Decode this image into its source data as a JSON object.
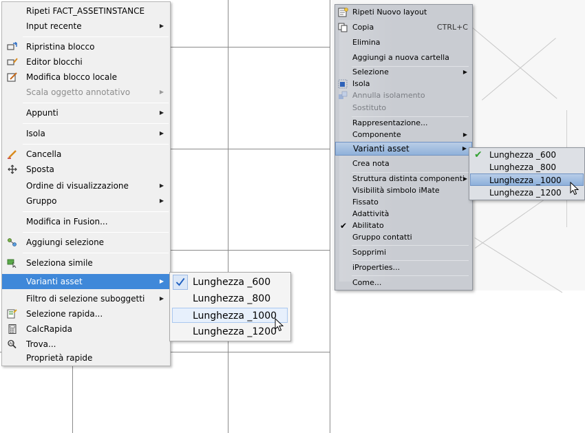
{
  "left_menu": {
    "items": [
      {
        "label": "Ripeti FACT_ASSETINSTANCE",
        "icon": "",
        "arrow": false,
        "disabled": false
      },
      {
        "label": "Input recente",
        "icon": "",
        "arrow": true,
        "disabled": false
      },
      {
        "label": "Ripristina blocco",
        "icon": "block-reset-icon",
        "arrow": false,
        "disabled": false
      },
      {
        "label": "Editor blocchi",
        "icon": "block-editor-icon",
        "arrow": false,
        "disabled": false
      },
      {
        "label": "Modifica blocco locale",
        "icon": "edit-block-icon",
        "arrow": false,
        "disabled": false
      },
      {
        "label": "Scala oggetto annotativo",
        "icon": "",
        "arrow": true,
        "disabled": true
      },
      {
        "label": "Appunti",
        "icon": "",
        "arrow": true,
        "disabled": false
      },
      {
        "label": "Isola",
        "icon": "",
        "arrow": true,
        "disabled": false
      },
      {
        "label": "Cancella",
        "icon": "eraser-icon",
        "arrow": false,
        "disabled": false
      },
      {
        "label": "Sposta",
        "icon": "move-icon",
        "arrow": false,
        "disabled": false
      },
      {
        "label": "Ordine di visualizzazione",
        "icon": "",
        "arrow": true,
        "disabled": false
      },
      {
        "label": "Gruppo",
        "icon": "",
        "arrow": true,
        "disabled": false
      },
      {
        "label": "Modifica in Fusion...",
        "icon": "",
        "arrow": false,
        "disabled": false
      },
      {
        "label": "Aggiungi selezione",
        "icon": "add-selection-icon",
        "arrow": false,
        "disabled": false
      },
      {
        "label": "Seleziona simile",
        "icon": "select-similar-icon",
        "arrow": false,
        "disabled": false
      },
      {
        "label": "Varianti asset",
        "icon": "",
        "arrow": true,
        "disabled": false,
        "highlighted": true
      },
      {
        "label": "Filtro di selezione suboggetti",
        "icon": "",
        "arrow": true,
        "disabled": false
      },
      {
        "label": "Selezione rapida...",
        "icon": "quick-select-icon",
        "arrow": false,
        "disabled": false
      },
      {
        "label": "CalcRapida",
        "icon": "calculator-icon",
        "arrow": false,
        "disabled": false
      },
      {
        "label": "Trova...",
        "icon": "find-icon",
        "arrow": false,
        "disabled": false
      },
      {
        "label": "Proprietà rapide",
        "icon": "",
        "arrow": false,
        "disabled": false
      }
    ]
  },
  "left_submenu": {
    "items": [
      {
        "label": "Lunghezza _600",
        "checked": true
      },
      {
        "label": "Lunghezza _800",
        "checked": false
      },
      {
        "label": "Lunghezza _1000",
        "checked": false,
        "hover": true
      },
      {
        "label": "Lunghezza _1200",
        "checked": false
      }
    ]
  },
  "right_menu": {
    "items": [
      {
        "label": "Ripeti Nuovo layout",
        "icon": "repeat-layout-icon"
      },
      {
        "label": "Copia",
        "shortcut": "CTRL+C",
        "icon": "copy-icon"
      },
      {
        "label": "Elimina"
      },
      {
        "label": "Aggiungi a nuova cartella"
      },
      {
        "label": "Selezione",
        "arrow": true
      },
      {
        "label": "Isola",
        "icon": "isolate-icon"
      },
      {
        "label": "Annulla isolamento",
        "disabled": true,
        "icon": "undo-isolate-icon"
      },
      {
        "label": "Sostituto",
        "disabled": true
      },
      {
        "label": "Rappresentazione..."
      },
      {
        "label": "Componente",
        "arrow": true
      },
      {
        "label": "Varianti asset",
        "arrow": true,
        "highlighted": true
      },
      {
        "label": "Crea nota"
      },
      {
        "label": "Struttura distinta componenti",
        "arrow": true
      },
      {
        "label": "Visibilità simbolo iMate"
      },
      {
        "label": "Fissato"
      },
      {
        "label": "Adattività"
      },
      {
        "label": "Abilitato",
        "checked": true
      },
      {
        "label": "Gruppo contatti"
      },
      {
        "label": "Sopprimi"
      },
      {
        "label": "iProperties..."
      },
      {
        "label": "Come..."
      }
    ]
  },
  "right_submenu": {
    "items": [
      {
        "label": "Lunghezza _600",
        "checked": true
      },
      {
        "label": "Lunghezza _800",
        "checked": false
      },
      {
        "label": "Lunghezza _1000",
        "checked": false,
        "hover": true
      },
      {
        "label": "Lunghezza _1200",
        "checked": false
      }
    ]
  },
  "colors": {
    "left_highlight": "#3f88d9",
    "right_highlight": "#8fb1da",
    "check_green": "#35a234",
    "check_blue": "#1f5fbf"
  }
}
